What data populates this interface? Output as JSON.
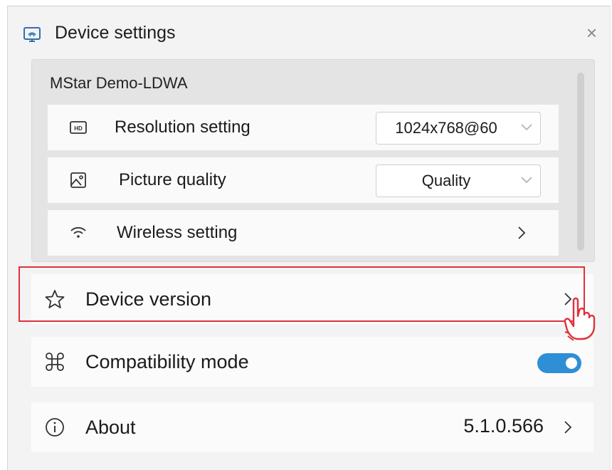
{
  "window": {
    "title": "Device settings",
    "close_glyph": "×",
    "icon": "cast-screen-icon"
  },
  "device": {
    "name": "MStar Demo-LDWA",
    "rows": [
      {
        "label": "Resolution setting",
        "icon": "hd-icon",
        "control": "dropdown",
        "value": "1024x768@60"
      },
      {
        "label": "Picture quality",
        "icon": "image-icon",
        "control": "dropdown",
        "value": "Quality"
      },
      {
        "label": "Wireless setting",
        "icon": "wifi-icon",
        "control": "chevron"
      }
    ]
  },
  "items": {
    "device_version": {
      "label": "Device version",
      "icon": "star-icon",
      "highlighted": true
    },
    "compatibility_mode": {
      "label": "Compatibility mode",
      "icon": "command-icon",
      "toggle_on": true
    },
    "about": {
      "label": "About",
      "icon": "info-icon",
      "version": "5.1.0.566"
    }
  },
  "colors": {
    "accent": "#2e8fd6",
    "highlight": "#e0303a",
    "background": "#f3f3f3"
  }
}
